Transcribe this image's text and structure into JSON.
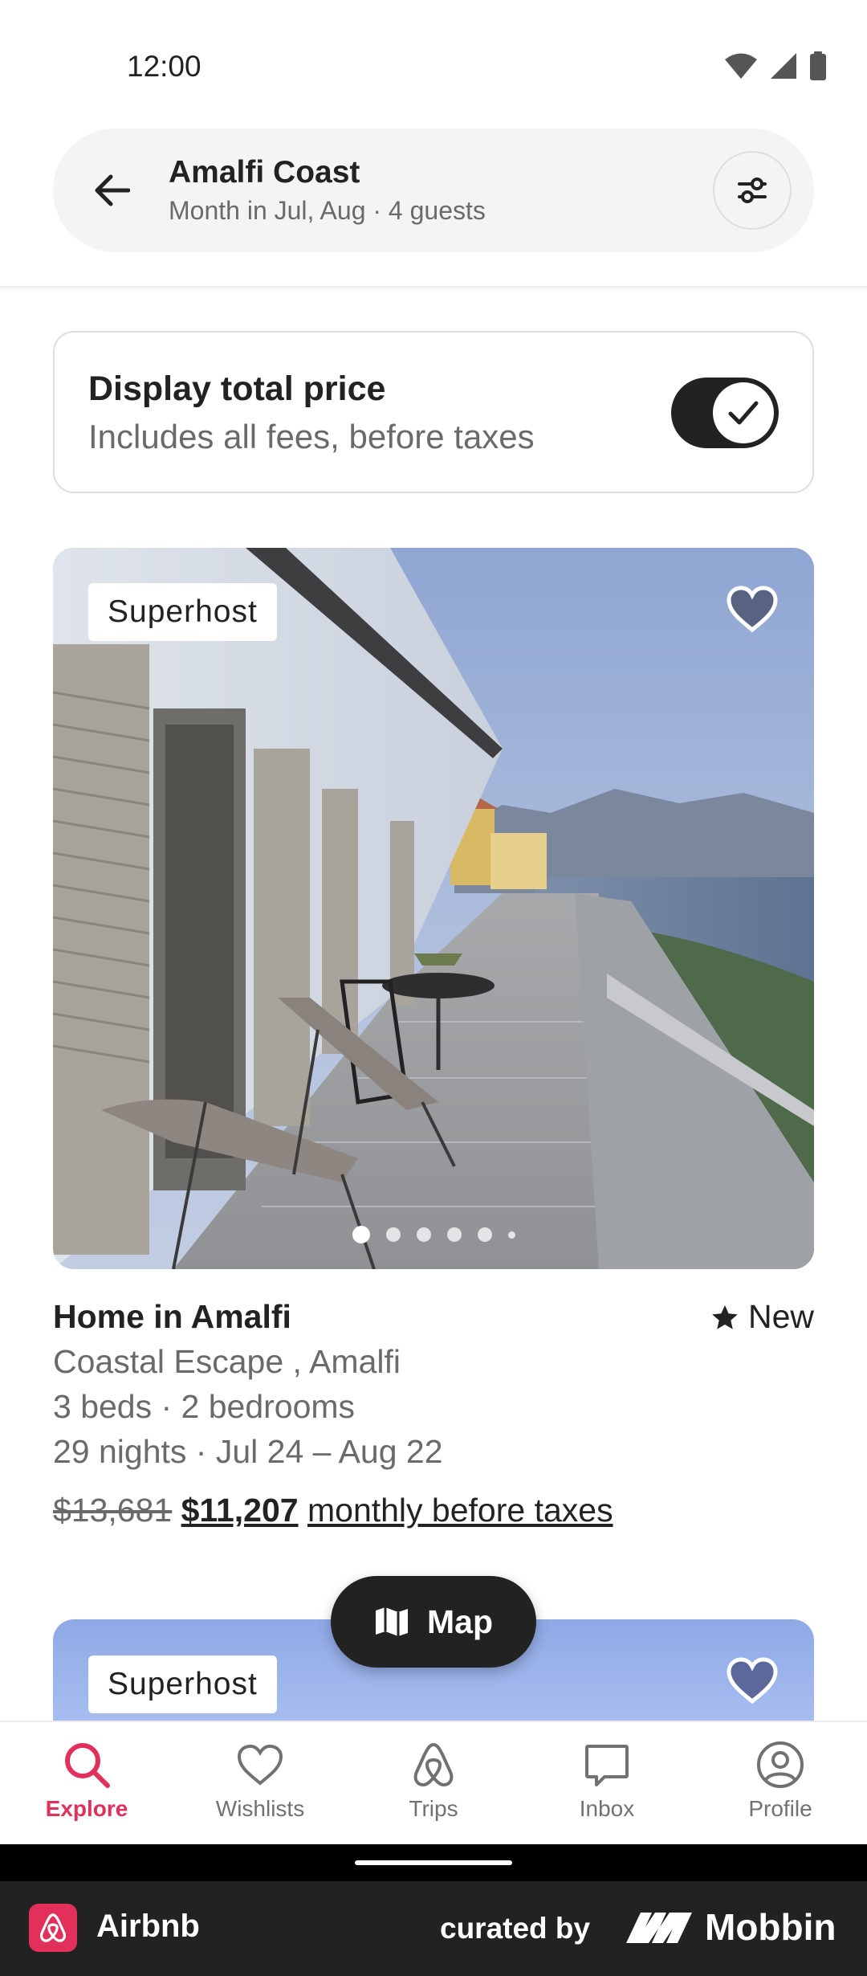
{
  "status_bar": {
    "time": "12:00"
  },
  "search": {
    "title": "Amalfi Coast",
    "subtitle": "Month in Jul, Aug · 4 guests"
  },
  "price_toggle": {
    "title": "Display total price",
    "subtitle": "Includes all fees, before taxes",
    "enabled": true
  },
  "listing": {
    "badge": "Superhost",
    "title": "Home in Amalfi",
    "rating": "New",
    "name_line": "Coastal Escape , Amalfi",
    "rooms_line": "3 beds · 2 bedrooms",
    "dates_line": "29 nights · Jul 24 – Aug 22",
    "old_price": "$13,681",
    "new_price": "$11,207",
    "price_suffix": "monthly before taxes",
    "photo_count_shown": 6,
    "active_photo_index": 0
  },
  "listing2": {
    "badge": "Superhost"
  },
  "map_button": {
    "label": "Map"
  },
  "nav": {
    "items": [
      {
        "label": "Explore",
        "icon": "search-icon",
        "active": true
      },
      {
        "label": "Wishlists",
        "icon": "heart-icon",
        "active": false
      },
      {
        "label": "Trips",
        "icon": "airbnb-logo-icon",
        "active": false
      },
      {
        "label": "Inbox",
        "icon": "message-icon",
        "active": false
      },
      {
        "label": "Profile",
        "icon": "user-icon",
        "active": false
      }
    ]
  },
  "footer": {
    "app_name": "Airbnb",
    "curated_by": "curated by",
    "brand": "Mobbin"
  },
  "colors": {
    "accent": "#e1315a",
    "text": "#222222",
    "muted": "#6a6a6a"
  }
}
